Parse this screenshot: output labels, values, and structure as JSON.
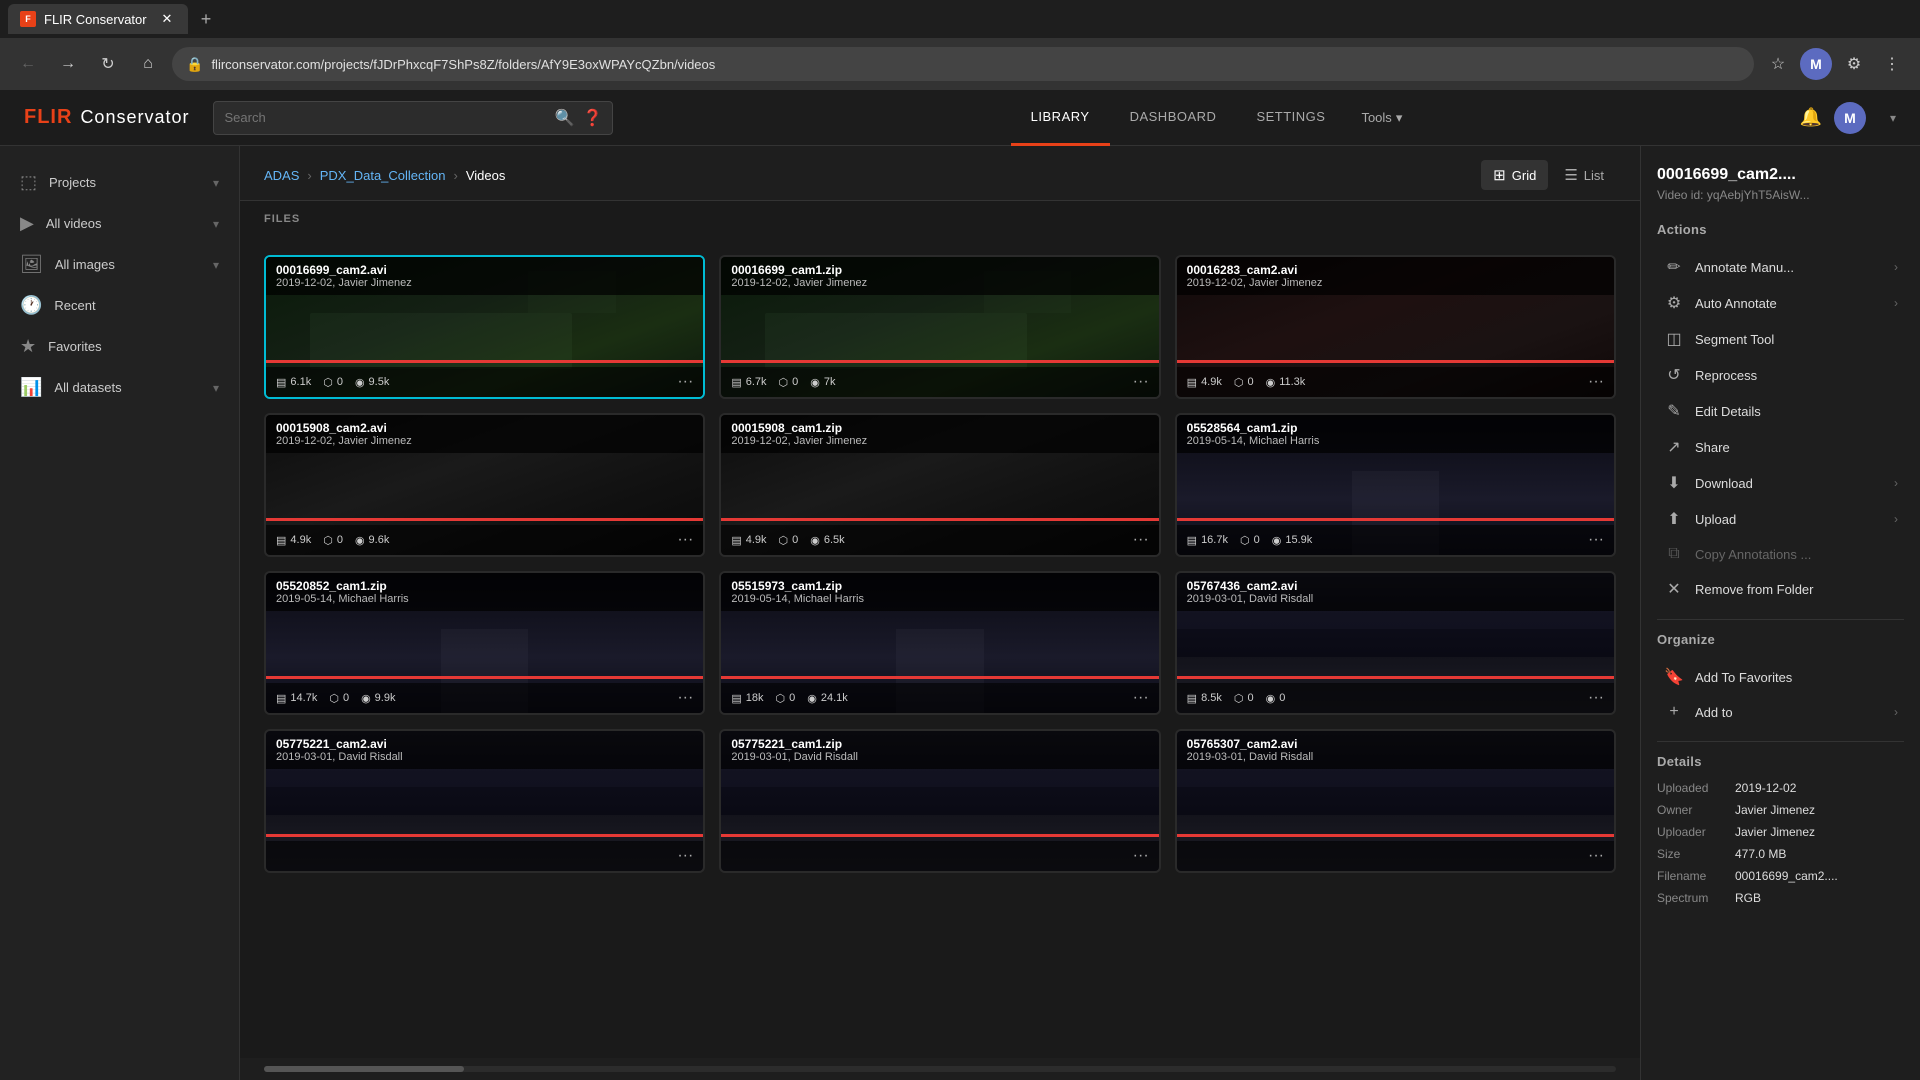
{
  "browser": {
    "tabs": [
      {
        "label": "FLIR Conservator",
        "active": true,
        "favicon": "F"
      }
    ],
    "url": "flirconservator.com/projects/fJDrPhxcqF7ShPs8Z/folders/AfY9E3oxWPAYcQZbn/videos",
    "new_tab_icon": "+"
  },
  "header": {
    "logo_flir": "FLIR",
    "logo_conservator": "Conservator",
    "search_placeholder": "Search",
    "nav_items": [
      "LIBRARY",
      "DASHBOARD",
      "SETTINGS"
    ],
    "active_nav": "LIBRARY",
    "tools_label": "Tools",
    "user_initial": "M",
    "user_name": ""
  },
  "sidebar": {
    "items": [
      {
        "id": "projects",
        "label": "Projects",
        "has_chevron": true
      },
      {
        "id": "all-videos",
        "label": "All videos",
        "has_chevron": true
      },
      {
        "id": "all-images",
        "label": "All images",
        "has_chevron": true
      },
      {
        "id": "recent",
        "label": "Recent",
        "has_chevron": false
      },
      {
        "id": "favorites",
        "label": "Favorites",
        "has_chevron": false
      },
      {
        "id": "all-datasets",
        "label": "All datasets",
        "has_chevron": true
      }
    ]
  },
  "breadcrumb": {
    "items": [
      "ADAS",
      "PDX_Data_Collection",
      "Videos"
    ],
    "links": [
      "ADAS",
      "PDX_Data_Collection"
    ],
    "current": "Videos"
  },
  "view_toggle": {
    "grid_label": "Grid",
    "list_label": "List",
    "active": "grid"
  },
  "files_section": {
    "label": "FILES"
  },
  "videos": [
    {
      "filename": "00016699_cam2.avi",
      "date": "2019-12-02, Javier Jimenez",
      "stat1": "6.1k",
      "stat2": "0",
      "stat3": "9.5k",
      "selected": true,
      "thumb_type": "nightvision"
    },
    {
      "filename": "00016699_cam1.zip",
      "date": "2019-12-02, Javier Jimenez",
      "stat1": "6.7k",
      "stat2": "0",
      "stat3": "7k",
      "selected": false,
      "thumb_type": "nightvision"
    },
    {
      "filename": "00016283_cam2.avi",
      "date": "2019-12-02, Javier Jimenez",
      "stat1": "4.9k",
      "stat2": "0",
      "stat3": "11.3k",
      "selected": false,
      "thumb_type": "nightvision_red"
    },
    {
      "filename": "00015908_cam2.avi",
      "date": "2019-12-02, Javier Jimenez",
      "stat1": "4.9k",
      "stat2": "0",
      "stat3": "9.6k",
      "selected": false,
      "thumb_type": "grayscale"
    },
    {
      "filename": "00015908_cam1.zip",
      "date": "2019-12-02, Javier Jimenez",
      "stat1": "4.9k",
      "stat2": "0",
      "stat3": "6.5k",
      "selected": false,
      "thumb_type": "grayscale"
    },
    {
      "filename": "05528564_cam1.zip",
      "date": "2019-05-14, Michael Harris",
      "stat1": "16.7k",
      "stat2": "0",
      "stat3": "15.9k",
      "selected": false,
      "thumb_type": "road"
    },
    {
      "filename": "05520852_cam1.zip",
      "date": "2019-05-14, Michael Harris",
      "stat1": "14.7k",
      "stat2": "0",
      "stat3": "9.9k",
      "selected": false,
      "thumb_type": "road"
    },
    {
      "filename": "05515973_cam1.zip",
      "date": "2019-05-14, Michael Harris",
      "stat1": "18k",
      "stat2": "0",
      "stat3": "24.1k",
      "selected": false,
      "thumb_type": "road"
    },
    {
      "filename": "05767436_cam2.avi",
      "date": "2019-03-01, David Risdall",
      "stat1": "8.5k",
      "stat2": "0",
      "stat3": "0",
      "selected": false,
      "thumb_type": "outdoor_road"
    },
    {
      "filename": "05775221_cam2.avi",
      "date": "2019-03-01, David Risdall",
      "stat1": "",
      "stat2": "",
      "stat3": "",
      "selected": false,
      "thumb_type": "outdoor_road"
    },
    {
      "filename": "05775221_cam1.zip",
      "date": "2019-03-01, David Risdall",
      "stat1": "",
      "stat2": "",
      "stat3": "",
      "selected": false,
      "thumb_type": "outdoor_road"
    },
    {
      "filename": "05765307_cam2.avi",
      "date": "2019-03-01, David Risdall",
      "stat1": "",
      "stat2": "",
      "stat3": "",
      "selected": false,
      "thumb_type": "outdoor_road"
    }
  ],
  "right_panel": {
    "title": "00016699_cam2....",
    "subtitle": "Video id: yqAebjYhT5AisW...",
    "actions_title": "Actions",
    "actions": [
      {
        "id": "annotate",
        "label": "Annotate Manu...",
        "has_arrow": true,
        "disabled": false
      },
      {
        "id": "auto-annotate",
        "label": "Auto Annotate",
        "has_arrow": true,
        "disabled": false
      },
      {
        "id": "segment-tool",
        "label": "Segment Tool",
        "has_arrow": false,
        "disabled": false
      },
      {
        "id": "reprocess",
        "label": "Reprocess",
        "has_arrow": false,
        "disabled": false
      },
      {
        "id": "edit-details",
        "label": "Edit Details",
        "has_arrow": false,
        "disabled": false
      },
      {
        "id": "share",
        "label": "Share",
        "has_arrow": false,
        "disabled": false
      },
      {
        "id": "download",
        "label": "Download",
        "has_arrow": true,
        "disabled": false
      },
      {
        "id": "upload",
        "label": "Upload",
        "has_arrow": true,
        "disabled": false
      },
      {
        "id": "copy-annotations",
        "label": "Copy Annotations ...",
        "has_arrow": false,
        "disabled": true
      },
      {
        "id": "remove-from-folder",
        "label": "Remove from Folder",
        "has_arrow": false,
        "disabled": false
      }
    ],
    "organize_title": "Organize",
    "organize_actions": [
      {
        "id": "add-to-favorites",
        "label": "Add To Favorites",
        "has_arrow": false,
        "disabled": false
      },
      {
        "id": "add-to",
        "label": "Add to",
        "has_arrow": true,
        "disabled": false
      }
    ],
    "details_title": "Details",
    "details": {
      "uploaded_label": "Uploaded",
      "uploaded_value": "2019-12-02",
      "owner_label": "Owner",
      "owner_value": "Javier Jimenez",
      "uploader_label": "Uploader",
      "uploader_value": "Javier Jimenez",
      "size_label": "Size",
      "size_value": "477.0 MB",
      "filename_label": "Filename",
      "filename_value": "00016699_cam2....",
      "spectrum_label": "Spectrum",
      "spectrum_value": "RGB"
    }
  },
  "colors": {
    "accent": "#e84118",
    "selected_border": "#00bcd4",
    "link": "#64b5f6"
  }
}
